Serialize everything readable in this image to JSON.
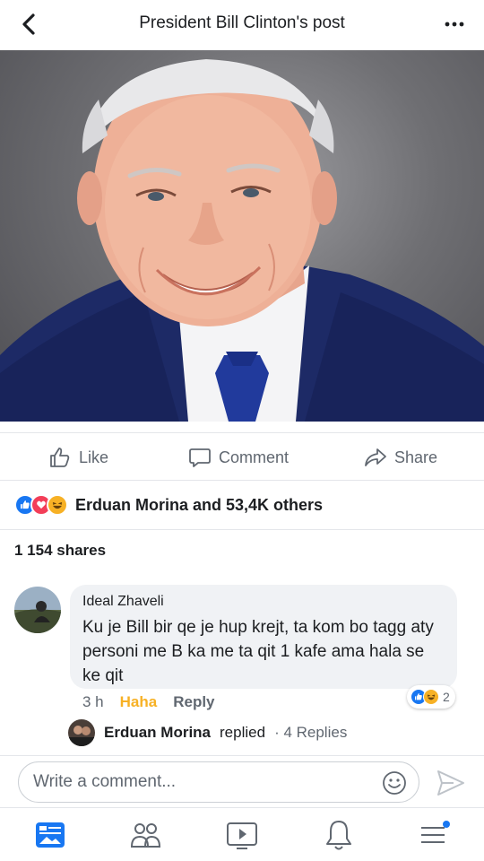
{
  "header": {
    "title": "President Bill Clinton's post",
    "back_icon": "chevron-left-icon",
    "more_icon": "more-dots-icon"
  },
  "post": {
    "image_description_icon": "portrait-photo",
    "actions": {
      "like": "Like",
      "comment": "Comment",
      "share": "Share"
    },
    "reactions_summary": "Erduan Morina and 53,4K others",
    "shares": "1 154 shares"
  },
  "comment": {
    "author": "Ideal Zhaveli",
    "text": "Ku je Bill bir qe je hup krejt, ta kom bo tagg aty personi me B ka me ta qit 1 kafe ama hala se ke qit",
    "time": "3 h",
    "reaction_label": "Haha",
    "reply_label": "Reply",
    "reaction_count": "2"
  },
  "replies": {
    "name": "Erduan Morina",
    "verb": "replied",
    "count": "· 4 Replies"
  },
  "composer": {
    "placeholder": "Write a comment..."
  },
  "colors": {
    "like_blue": "#1877f2",
    "love_red": "#f33e58",
    "haha_yellow": "#f7b125",
    "muted_text": "#606770"
  },
  "tabs": [
    "news-feed-icon",
    "friends-icon",
    "watch-icon",
    "notifications-icon",
    "menu-icon"
  ]
}
